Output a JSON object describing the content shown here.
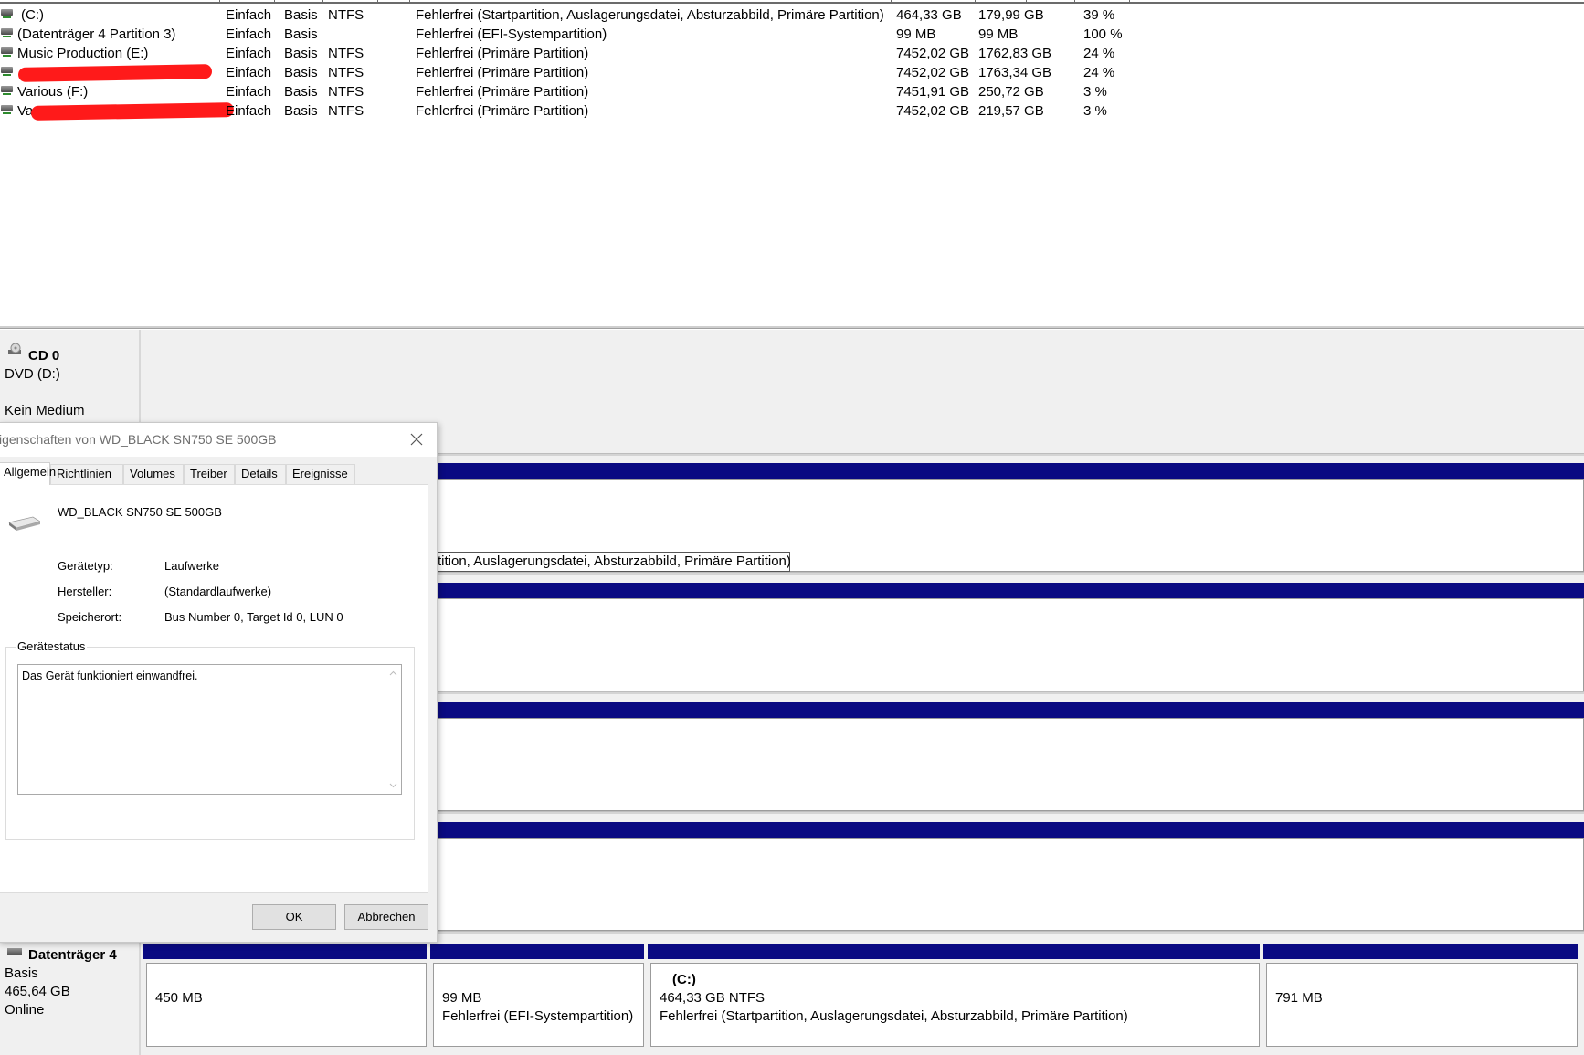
{
  "volumes": [
    {
      "name": "(C:)",
      "layout": "Einfach",
      "type": "Basis",
      "fs": "NTFS",
      "status": "Fehlerfrei (Startpartition, Auslagerungsdatei, Absturzabbild, Primäre Partition)",
      "capacity": "464,33 GB",
      "free": "179,99 GB",
      "pct": "39 %"
    },
    {
      "name": "(Datenträger 4 Partition 3)",
      "layout": "Einfach",
      "type": "Basis",
      "fs": "",
      "status": "Fehlerfrei (EFI-Systempartition)",
      "capacity": "99 MB",
      "free": "99 MB",
      "pct": "100 %"
    },
    {
      "name": "Music Production (E:)",
      "layout": "Einfach",
      "type": "Basis",
      "fs": "NTFS",
      "status": "Fehlerfrei (Primäre Partition)",
      "capacity": "7452,02 GB",
      "free": "1762,83 GB",
      "pct": "24 %"
    },
    {
      "name": "",
      "layout": "Einfach",
      "type": "Basis",
      "fs": "NTFS",
      "status": "Fehlerfrei (Primäre Partition)",
      "capacity": "7452,02 GB",
      "free": "1763,34 GB",
      "pct": "24 %"
    },
    {
      "name": "Various (F:)",
      "layout": "Einfach",
      "type": "Basis",
      "fs": "NTFS",
      "status": "Fehlerfrei (Primäre Partition)",
      "capacity": "7451,91 GB",
      "free": "250,72 GB",
      "pct": "3 %"
    },
    {
      "name": "Va",
      "layout": "Einfach",
      "type": "Basis",
      "fs": "NTFS",
      "status": "Fehlerfrei (Primäre Partition)",
      "capacity": "7452,02 GB",
      "free": "219,57 GB",
      "pct": "3 %"
    }
  ],
  "cd0": {
    "title": "CD 0",
    "drive": "DVD (D:)",
    "media": "Kein Medium"
  },
  "partial_label": "tition, Auslagerungsdatei, Absturzabbild, Primäre Partition)",
  "disk4": {
    "title": "Datenträger 4",
    "type": "Basis",
    "size": "465,64 GB",
    "state": "Online",
    "partitions": [
      {
        "title": "",
        "size": "450 MB",
        "status": ""
      },
      {
        "title": "",
        "size": "99 MB",
        "status": "Fehlerfrei (EFI-Systempartition)"
      },
      {
        "title": "(C:)",
        "size": "464,33 GB NTFS",
        "status": "Fehlerfrei (Startpartition, Auslagerungsdatei, Absturzabbild, Primäre Partition)"
      },
      {
        "title": "",
        "size": "791 MB",
        "status": ""
      }
    ]
  },
  "dialog": {
    "title": "igenschaften von WD_BLACK SN750 SE 500GB",
    "tabs": [
      "Allgemein",
      "Richtlinien",
      "Volumes",
      "Treiber",
      "Details",
      "Ereignisse"
    ],
    "device_name": "WD_BLACK SN750 SE 500GB",
    "props": [
      {
        "key": "Gerätetyp:",
        "value": "Laufwerke"
      },
      {
        "key": "Hersteller:",
        "value": "(Standardlaufwerke)"
      },
      {
        "key": "Speicherort:",
        "value": "Bus Number 0, Target Id 0, LUN 0"
      }
    ],
    "status_group": "Gerätestatus",
    "status_text": "Das Gerät funktioniert einwandfrei.",
    "ok": "OK",
    "cancel": "Abbrechen"
  },
  "colors": {
    "partition_bar": "#0a0a82",
    "redaction": "#ff1a1a"
  }
}
